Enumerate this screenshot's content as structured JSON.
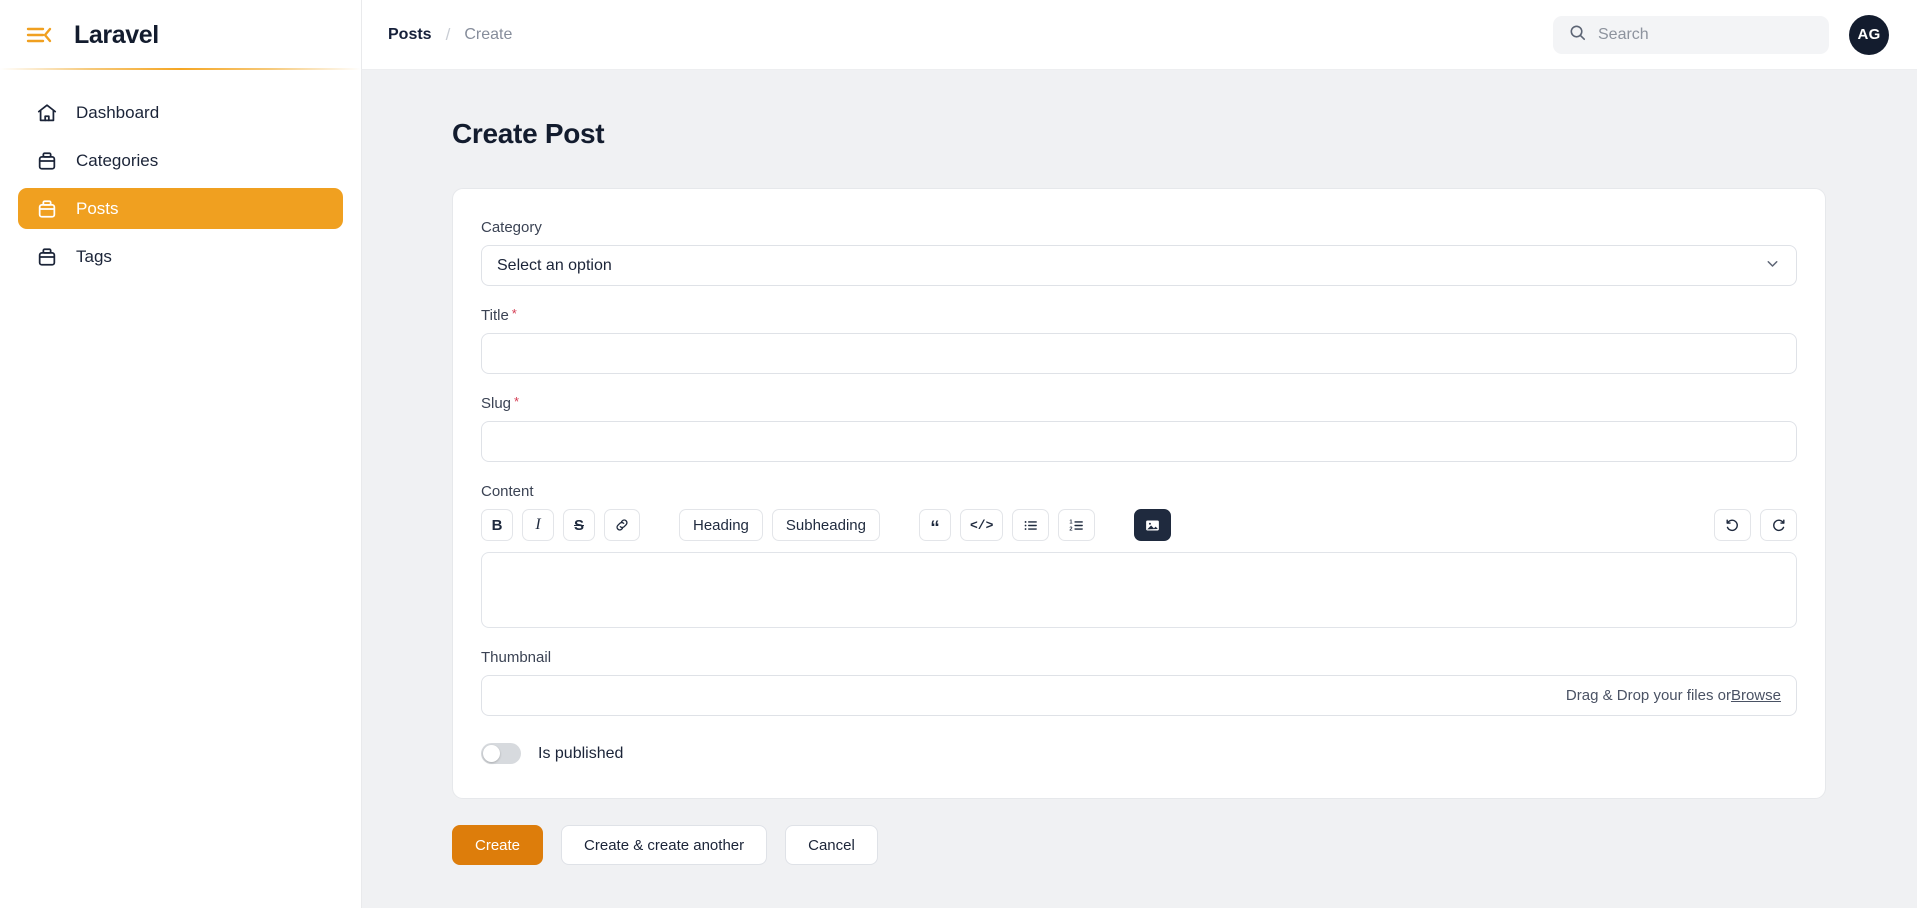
{
  "sidebar": {
    "brand": "Laravel",
    "menu_icon": "hamburger-collapse-icon",
    "items": [
      {
        "label": "Dashboard",
        "icon": "home-icon",
        "active": false
      },
      {
        "label": "Categories",
        "icon": "archive-box-icon",
        "active": false
      },
      {
        "label": "Posts",
        "icon": "archive-box-icon",
        "active": true
      },
      {
        "label": "Tags",
        "icon": "archive-box-icon",
        "active": false
      }
    ]
  },
  "topbar": {
    "breadcrumb": {
      "parent": "Posts",
      "separator": "/",
      "current": "Create"
    },
    "search": {
      "placeholder": "Search",
      "value": "",
      "icon": "search-icon"
    },
    "avatar": {
      "initials": "AG"
    }
  },
  "page": {
    "title": "Create Post"
  },
  "form": {
    "category": {
      "label": "Category",
      "placeholder": "Select an option",
      "required": false,
      "chevron": "chevron-down-icon"
    },
    "title": {
      "label": "Title",
      "value": "",
      "required": true,
      "required_mark": "*"
    },
    "slug": {
      "label": "Slug",
      "value": "",
      "required": true,
      "required_mark": "*"
    },
    "content": {
      "label": "Content",
      "value": "",
      "toolbar": {
        "group_format": [
          {
            "label": "B",
            "name": "bold-icon"
          },
          {
            "label": "I",
            "name": "italic-icon"
          },
          {
            "label": "S",
            "name": "strikethrough-icon"
          },
          {
            "label": "",
            "name": "link-icon"
          }
        ],
        "group_headings": [
          {
            "label": "Heading",
            "name": "heading-button"
          },
          {
            "label": "Subheading",
            "name": "subheading-button"
          }
        ],
        "group_blocks": [
          {
            "label": "“",
            "name": "blockquote-icon"
          },
          {
            "label": "</>",
            "name": "code-block-icon"
          },
          {
            "label": "",
            "name": "bullet-list-icon"
          },
          {
            "label": "",
            "name": "ordered-list-icon"
          }
        ],
        "group_media": [
          {
            "label": "",
            "name": "image-icon"
          }
        ],
        "group_history": [
          {
            "label": "",
            "name": "undo-icon"
          },
          {
            "label": "",
            "name": "redo-icon"
          }
        ]
      }
    },
    "thumbnail": {
      "label": "Thumbnail",
      "drop_text": "Drag & Drop your files or ",
      "browse_label": "Browse"
    },
    "is_published": {
      "label": "Is published",
      "checked": false
    }
  },
  "actions": [
    {
      "label": "Create",
      "style": "primary"
    },
    {
      "label": "Create & create another",
      "style": "outline"
    },
    {
      "label": "Cancel",
      "style": "outline"
    }
  ],
  "colors": {
    "accent": "#f0a020",
    "accent_dark": "#dd7d0b",
    "navy": "#131c2e",
    "page_bg": "#f0f1f3",
    "required": "#d43b52"
  }
}
